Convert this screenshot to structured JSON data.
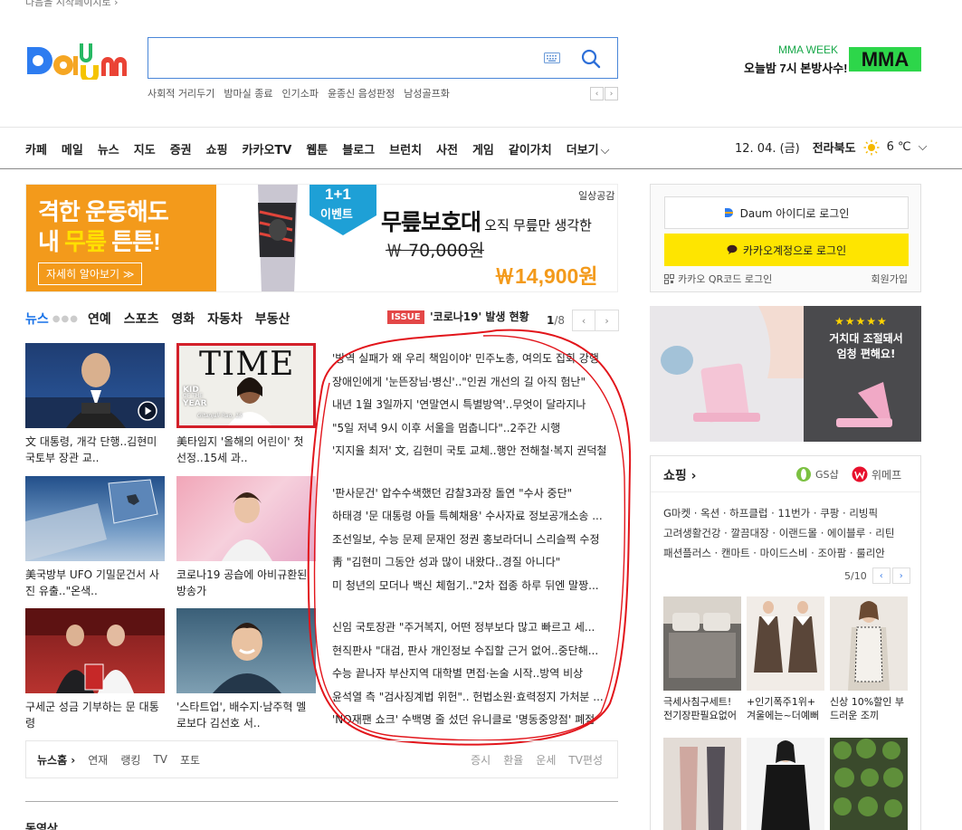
{
  "top_hint": "다음을 시작페이지로 ›",
  "search": {
    "placeholder": "",
    "keywords": [
      "사회적 거리두기",
      "밤마실 종료",
      "인기소파",
      "윤종신 음성판정",
      "남성골프화"
    ],
    "nav_prev": "‹",
    "nav_next": "›"
  },
  "mma": {
    "week": "MMA WEEK",
    "sub": "오늘밤 7시 본방사수!",
    "logo": "MMA"
  },
  "gnb": [
    "카페",
    "메일",
    "뉴스",
    "지도",
    "증권",
    "쇼핑",
    "카카오TV",
    "웹툰",
    "블로그",
    "브런치",
    "사전",
    "게임",
    "같이가치",
    "더보기"
  ],
  "date": "12. 04. (금)",
  "region": "전라북도",
  "temp": "6 ℃",
  "ad_top": {
    "line1": "격한 운동해도",
    "line2a": "내 ",
    "line2b": "무릎",
    "line2c": " 튼튼!",
    "cta": "자세히 알아보기 ≫",
    "badge_top": "1+1",
    "badge_bottom": "이벤트",
    "title": "무릎보호대",
    "title_sub": " 오직 무릎만 생각한",
    "old_price": "￦ 70,000원",
    "new_price": "￦14,900원",
    "brand": "일상공감"
  },
  "news_tabs": [
    "뉴스",
    "연예",
    "스포츠",
    "영화",
    "자동차",
    "부동산"
  ],
  "issue": {
    "badge": "ISSUE",
    "text": "'코로나19' 발생 현황"
  },
  "pager": {
    "current": "1",
    "total": "/8",
    "prev": "‹",
    "next": "›"
  },
  "thumbs": [
    "文 대통령, 개각 단행..김현미 국토부 장관 교..",
    "美타임지 '올해의 어린이' 첫 선정..15세 과..",
    "美국방부 UFO 기밀문건서 사진 유출..\"온색..",
    "코로나19 공습에 아비규환된 방송가",
    "구세군 성금 기부하는 문 대통령",
    "'스타트업', 배수지·남주혁 멜로보다 김선호 서.."
  ],
  "time_cover": {
    "logo": "TIME",
    "kid": "KID",
    "of": "OF THE",
    "year": "YEAR",
    "name": "Gitanjali Rao, 15"
  },
  "headlines": [
    [
      "'방역 실패가 왜 우리 책임이야' 민주노총, 여의도 집회 강행",
      "장애인에게 '눈뜬장님·병신'..\"인권 개선의 길 아직 험난\"",
      "내년 1월 3일까지 '연말연시 특별방역'..무엇이 달라지나",
      "\"5일 저녁 9시 이후 서울을 멈춥니다\"..2주간 시행",
      "'지지율 최저' 文, 김현미 국토 교체..행안 전해철·복지 권덕철"
    ],
    [
      "'판사문건' 압수수색했던 감찰3과장 돌연 \"수사 중단\"",
      "하태경 '문 대통령 아들 특혜채용' 수사자료 정보공개소송 ...",
      "조선일보, 수능 문제 문재인 정권 홍보라더니 스리슬쩍 수정",
      "靑 \"김현미 그동안 성과 많이 내왔다..경질 아니다\"",
      "미 청년의 모더나 백신 체험기..\"2차 접종 하루 뒤엔 말짱..."
    ],
    [
      "신임 국토장관 \"주거복지, 어떤 정부보다 많고 빠르고 세...",
      "현직판사 \"대검, 판사 개인정보 수집할 근거 없어..중단해...",
      "수능 끝나자 부산지역 대학별 면접·논술 시작..방역 비상",
      "윤석열 측 \"검사징계법 위헌\".. 헌법소원·효력정지 가처분 ...",
      "'NO재팬 쇼크' 수백명 줄 섰던 유니클로 '명동중앙점' 폐점"
    ]
  ],
  "news_bar": {
    "home": "뉴스홈 ›",
    "links": [
      "연재",
      "랭킹",
      "TV",
      "포토"
    ],
    "right": [
      "증시",
      "환율",
      "운세",
      "TV편성"
    ]
  },
  "bottom_peek": "동영상",
  "login": {
    "daum": "Daum 아이디로 로그인",
    "kakao": "카카오계정으로 로그인",
    "qr": "카카오 QR코드 로그인",
    "join": "회원가입"
  },
  "r_ad": {
    "stars": "★★★★★",
    "text1": "거치대 조절돼서",
    "text2": "엄청 편해요!"
  },
  "shopping": {
    "title": "쇼핑 ›",
    "gs": "GS샵",
    "wemake": "위메프",
    "links": [
      "G마켓 · 옥션 · 하프클럽 · 11번가 · 쿠팡 · 리빙픽",
      "고려생활건강 · 깔끔대장 · 이랜드몰 · 에이블루 · 리틴",
      "패션플러스 · 캔마트 · 마이드스비 · 조아팜 · 룰리안"
    ],
    "pager": "5/10",
    "products": [
      "극세사침구세트! 전기장판필요없어",
      "+인기폭주1위+ 겨울에는~더예뻐",
      "신상 10%할인 부드러운 조끼",
      "",
      "",
      ""
    ]
  },
  "colors": {
    "accent": "#1a73e8",
    "issue": "#e34747",
    "kakao": "#fee500",
    "ad_orange": "#f39a1b",
    "mma_green": "#2dd64a"
  }
}
